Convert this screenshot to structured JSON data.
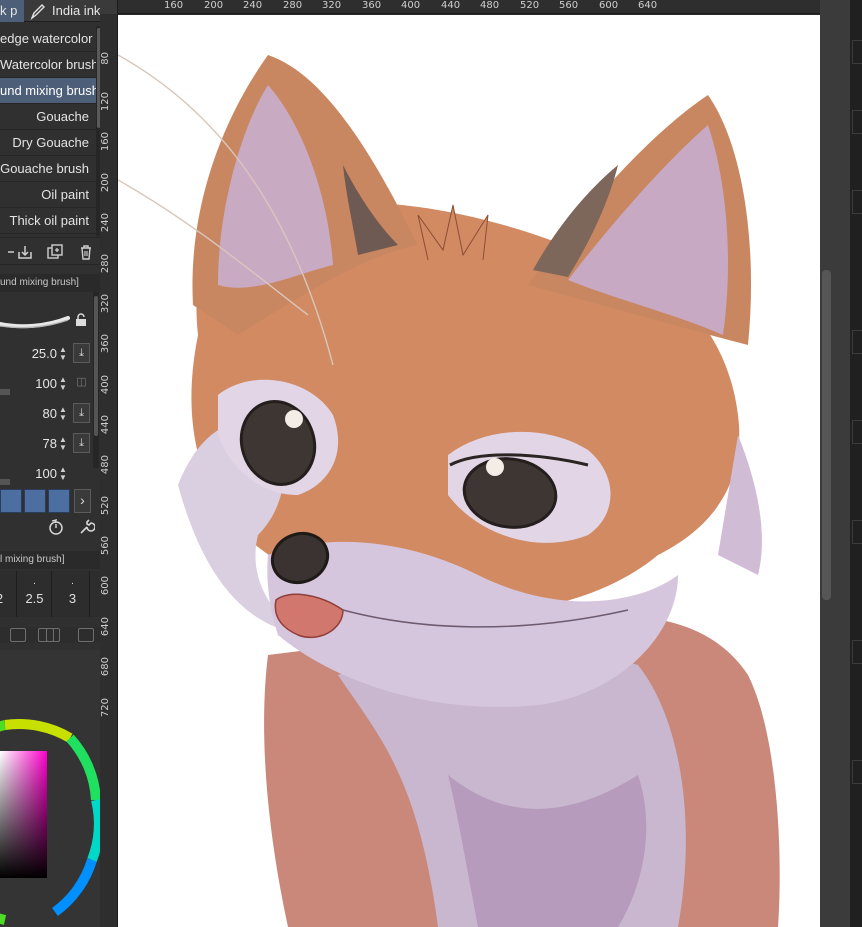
{
  "tabs": [
    {
      "label": "k p"
    },
    {
      "label": "India ink",
      "icon": "pen-nib-icon"
    }
  ],
  "brush_list": {
    "items": [
      {
        "label": "edge watercolor"
      },
      {
        "label": "Watercolor brush"
      },
      {
        "label": "und mixing brush",
        "selected": true
      },
      {
        "label": "Gouache"
      },
      {
        "label": "Dry Gouache"
      },
      {
        "label": "Gouache brush"
      },
      {
        "label": "Oil paint"
      },
      {
        "label": "Thick oil paint"
      }
    ]
  },
  "tool_property": {
    "header": "und mixing brush]",
    "rows": [
      {
        "value": "25.0",
        "has_button": true
      },
      {
        "value": "100",
        "has_button": false
      },
      {
        "value": "80",
        "has_button": true
      },
      {
        "value": "78",
        "has_button": true
      },
      {
        "value": "100",
        "has_button": false
      }
    ]
  },
  "brush_size": {
    "header": "l mixing brush]",
    "sizes": [
      "2",
      "2.5",
      "3"
    ]
  },
  "ruler": {
    "top_labels": [
      "160",
      "200",
      "240",
      "280",
      "320",
      "360",
      "400",
      "440",
      "480",
      "520",
      "560",
      "600",
      "640"
    ],
    "left_labels": [
      "80",
      "120",
      "160",
      "200",
      "240",
      "280",
      "320",
      "360",
      "400",
      "440",
      "480",
      "520",
      "560",
      "600",
      "640",
      "680",
      "720"
    ]
  },
  "colors": {
    "accent_selected": "#4d5e79",
    "panel_bg": "#303030",
    "canvas_bg": "#ffffff"
  }
}
